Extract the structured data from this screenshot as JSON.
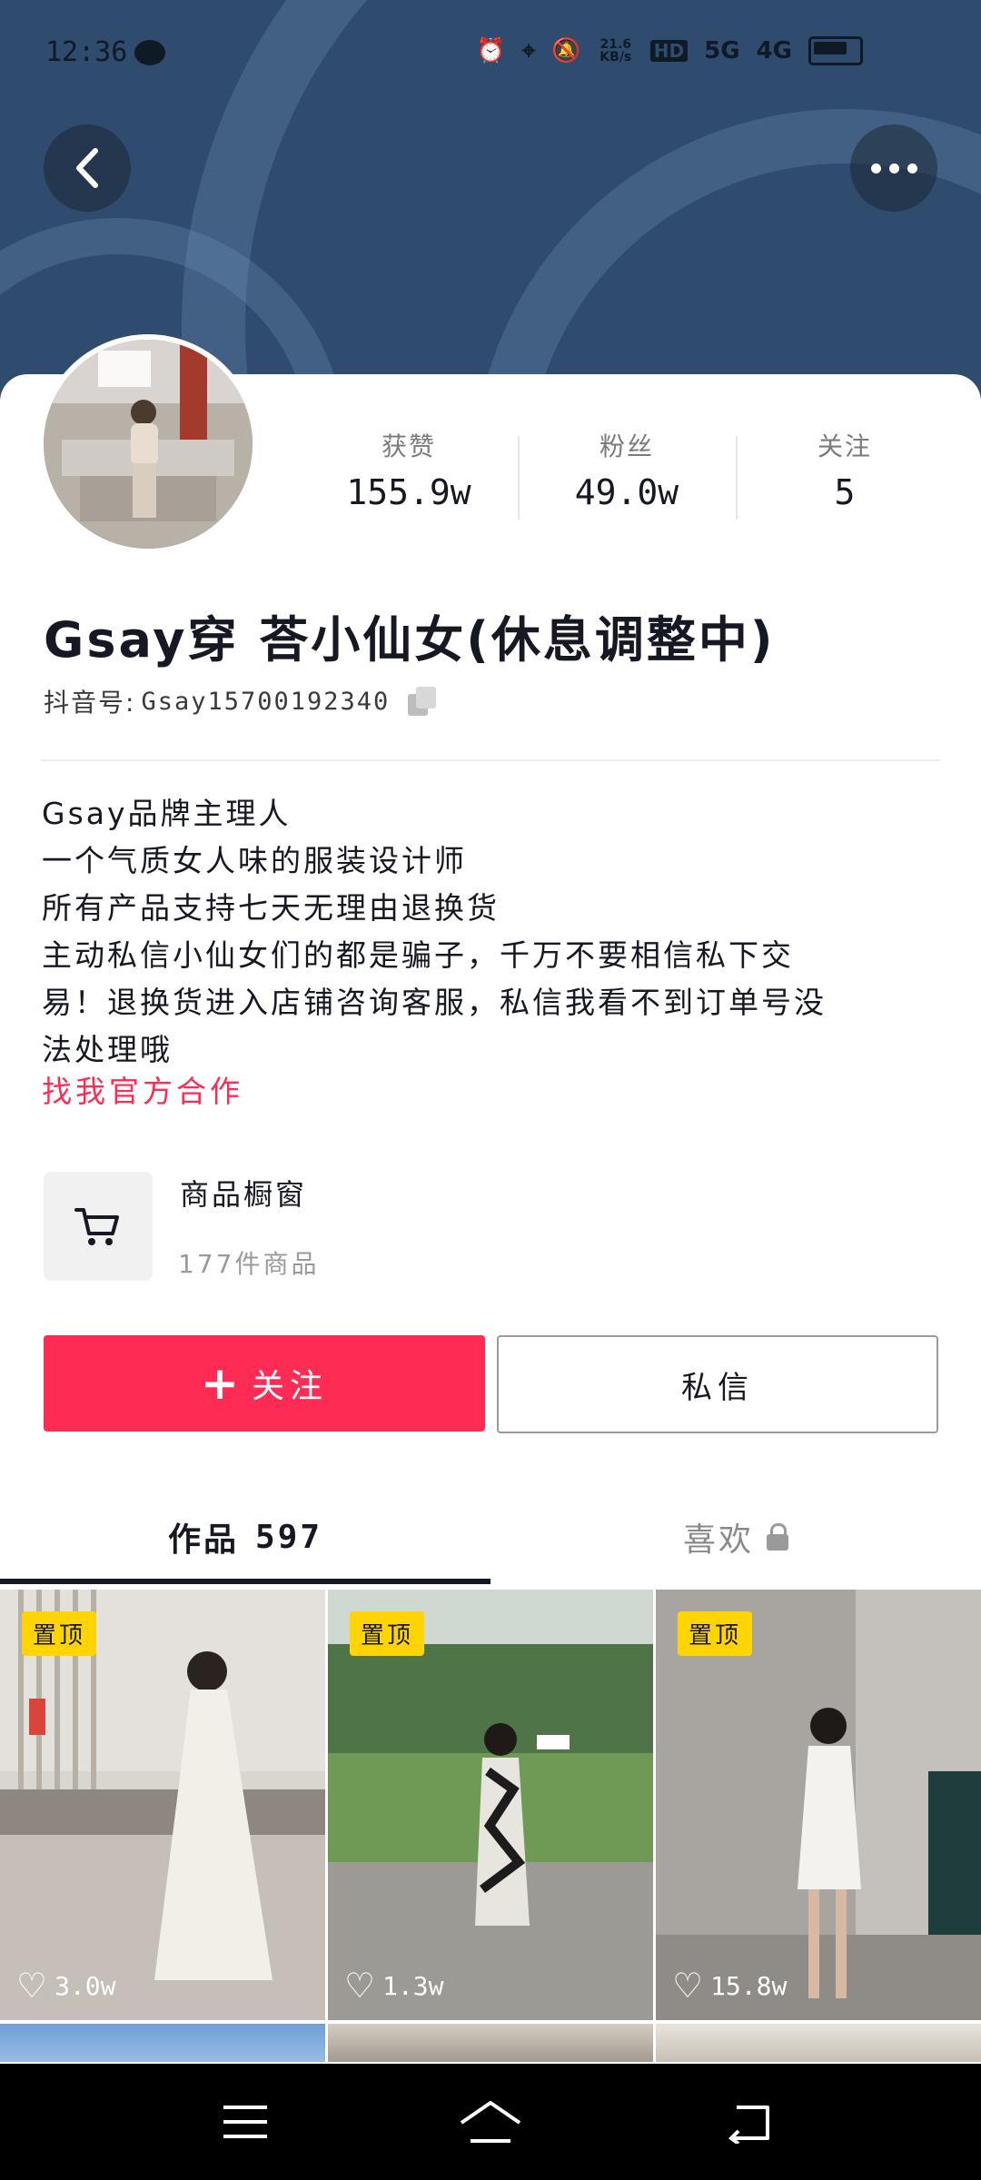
{
  "status_bar": {
    "time": "12:36",
    "net_speed": "21.6 KB/s",
    "hd_label": "HD",
    "net_5g": "5G",
    "net_4g": "4G"
  },
  "header": {
    "back_icon": "chevron-left-icon",
    "more_icon": "more-horizontal-icon"
  },
  "profile": {
    "stats": [
      {
        "label": "获赞",
        "value": "155.9w"
      },
      {
        "label": "粉丝",
        "value": "49.0w"
      },
      {
        "label": "关注",
        "value": "5"
      }
    ],
    "name": "Gsay穿 荅小仙女(休息调整中)",
    "douyin_id_label": "抖音号:",
    "douyin_id": "Gsay15700192340",
    "bio_lines": [
      "Gsay品牌主理人",
      "一个气质女人味的服装设计师",
      "所有产品支持七天无理由退换货",
      "主动私信小仙女们的都是骗子，千万不要相信私下交",
      "易！退换货进入店铺咨询客服，私信我看不到订单号没",
      "法处理哦"
    ],
    "bio_link": "找我官方合作"
  },
  "shop": {
    "title": "商品橱窗",
    "count": "177件商品"
  },
  "actions": {
    "follow_label": "关注",
    "message_label": "私信"
  },
  "tabs": {
    "works_label": "作品",
    "works_count": "597",
    "likes_label": "喜欢"
  },
  "videos": [
    {
      "pinned_label": "置顶",
      "likes": "3.0w"
    },
    {
      "pinned_label": "置顶",
      "likes": "1.3w"
    },
    {
      "pinned_label": "置顶",
      "likes": "15.8w"
    }
  ],
  "colors": {
    "accent": "#fe2c55",
    "pin_badge": "#ffd400",
    "banner": "#2f4b6e"
  }
}
